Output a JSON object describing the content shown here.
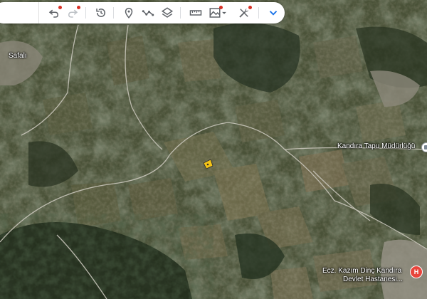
{
  "toolbar": {
    "buttons": [
      {
        "name": "undo-button",
        "icon": "undo-icon",
        "has_dot": true
      },
      {
        "name": "redo-button",
        "icon": "redo-icon",
        "has_dot": true
      },
      {
        "name": "history-button",
        "icon": "history-icon",
        "has_dot": false
      },
      {
        "name": "add-placemark-button",
        "icon": "placemark-icon",
        "has_dot": false
      },
      {
        "name": "draw-path-button",
        "icon": "path-icon",
        "has_dot": false
      },
      {
        "name": "layers-button",
        "icon": "layers-icon",
        "has_dot": false
      },
      {
        "name": "measure-button",
        "icon": "ruler-icon",
        "has_dot": false
      },
      {
        "name": "terrain-button",
        "icon": "terrain-icon",
        "has_dot": true
      },
      {
        "name": "tools-button",
        "icon": "tools-icon",
        "has_dot": true
      },
      {
        "name": "expand-button",
        "icon": "chevron-down-icon",
        "has_dot": false
      }
    ],
    "accent_color": "#1a73e8",
    "dot_color": "#d93025"
  },
  "map": {
    "labels": {
      "village": "Safalı",
      "land_registry": "Kandıra Tapu Müdürlüğü",
      "hospital_line1": "Ecz. Kazım Dinç Kandıra",
      "hospital_line2": "Devlet Hastanesi..."
    },
    "hospital_icon_letter": "H",
    "parcel_color": "#f5c518"
  }
}
